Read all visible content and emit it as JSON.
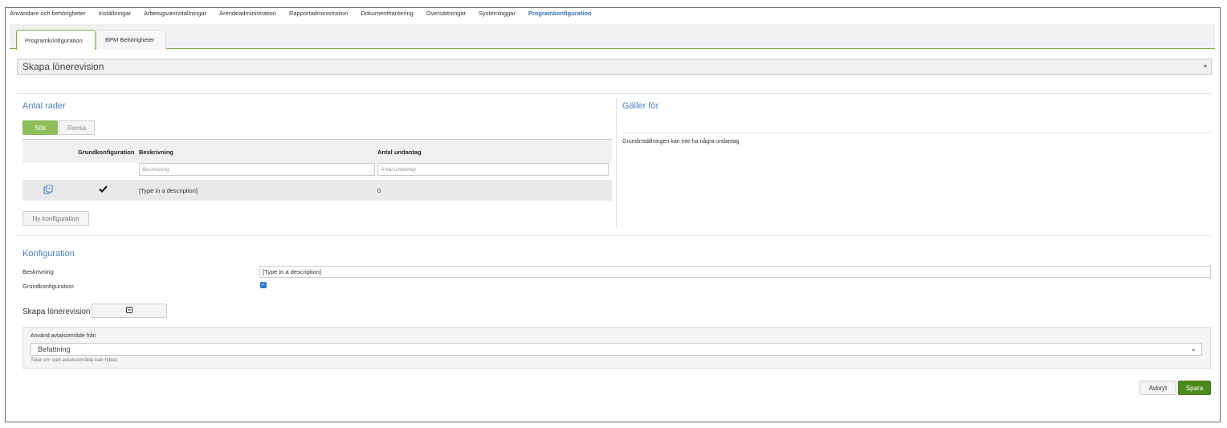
{
  "topnav": {
    "items": [
      {
        "label": "Användare och behörigheter",
        "active": false
      },
      {
        "label": "Inställningar",
        "active": false
      },
      {
        "label": "Arbetsgivarinställningar",
        "active": false
      },
      {
        "label": "Ärendeadministration",
        "active": false
      },
      {
        "label": "Rapportadministration",
        "active": false
      },
      {
        "label": "Dokumenthantering",
        "active": false
      },
      {
        "label": "Översättningar",
        "active": false
      },
      {
        "label": "Systemloggar",
        "active": false
      },
      {
        "label": "Programkonfiguration",
        "active": true
      }
    ]
  },
  "tabs": {
    "tab1": "Programkonfiguration",
    "tab2": "BPM Behörigheter"
  },
  "program_select": {
    "value": "Skapa lönerevision"
  },
  "rows_section": {
    "title": "Antal rader",
    "search_label": "Sök",
    "clear_label": "Rensa",
    "columns": {
      "base": "Grundkonfiguration",
      "description": "Beskrivning",
      "exceptions": "Antal undantag"
    },
    "filters": {
      "description_placeholder": "Beskrivning",
      "exceptions_placeholder": "Antal undantag"
    },
    "row": {
      "description": "[Type in a description]",
      "exceptions": "0"
    },
    "new_config_label": "Ny konfiguration"
  },
  "applies_section": {
    "title": "Gäller för",
    "text": "Grundinställningen kan inte ha några undantag"
  },
  "config_section": {
    "title": "Konfiguration",
    "description_label": "Beskrivning",
    "description_value": "[Type in a description]",
    "base_label": "Grundkonfiguration",
    "base_checked": true,
    "subsection_label": "Skapa lönerevision"
  },
  "agreement_panel": {
    "label": "Använd avtalsområde från",
    "value": "Befattning",
    "help": "Talar om vart avtalsområde kan hittas."
  },
  "actions": {
    "cancel_label": "Avbryt",
    "save_label": "Spara"
  },
  "colors": {
    "accent_green": "#7ab03a",
    "save_green": "#4d8a1d",
    "link_blue": "#4a7fc0",
    "checkbox_blue": "#2f78d0"
  }
}
